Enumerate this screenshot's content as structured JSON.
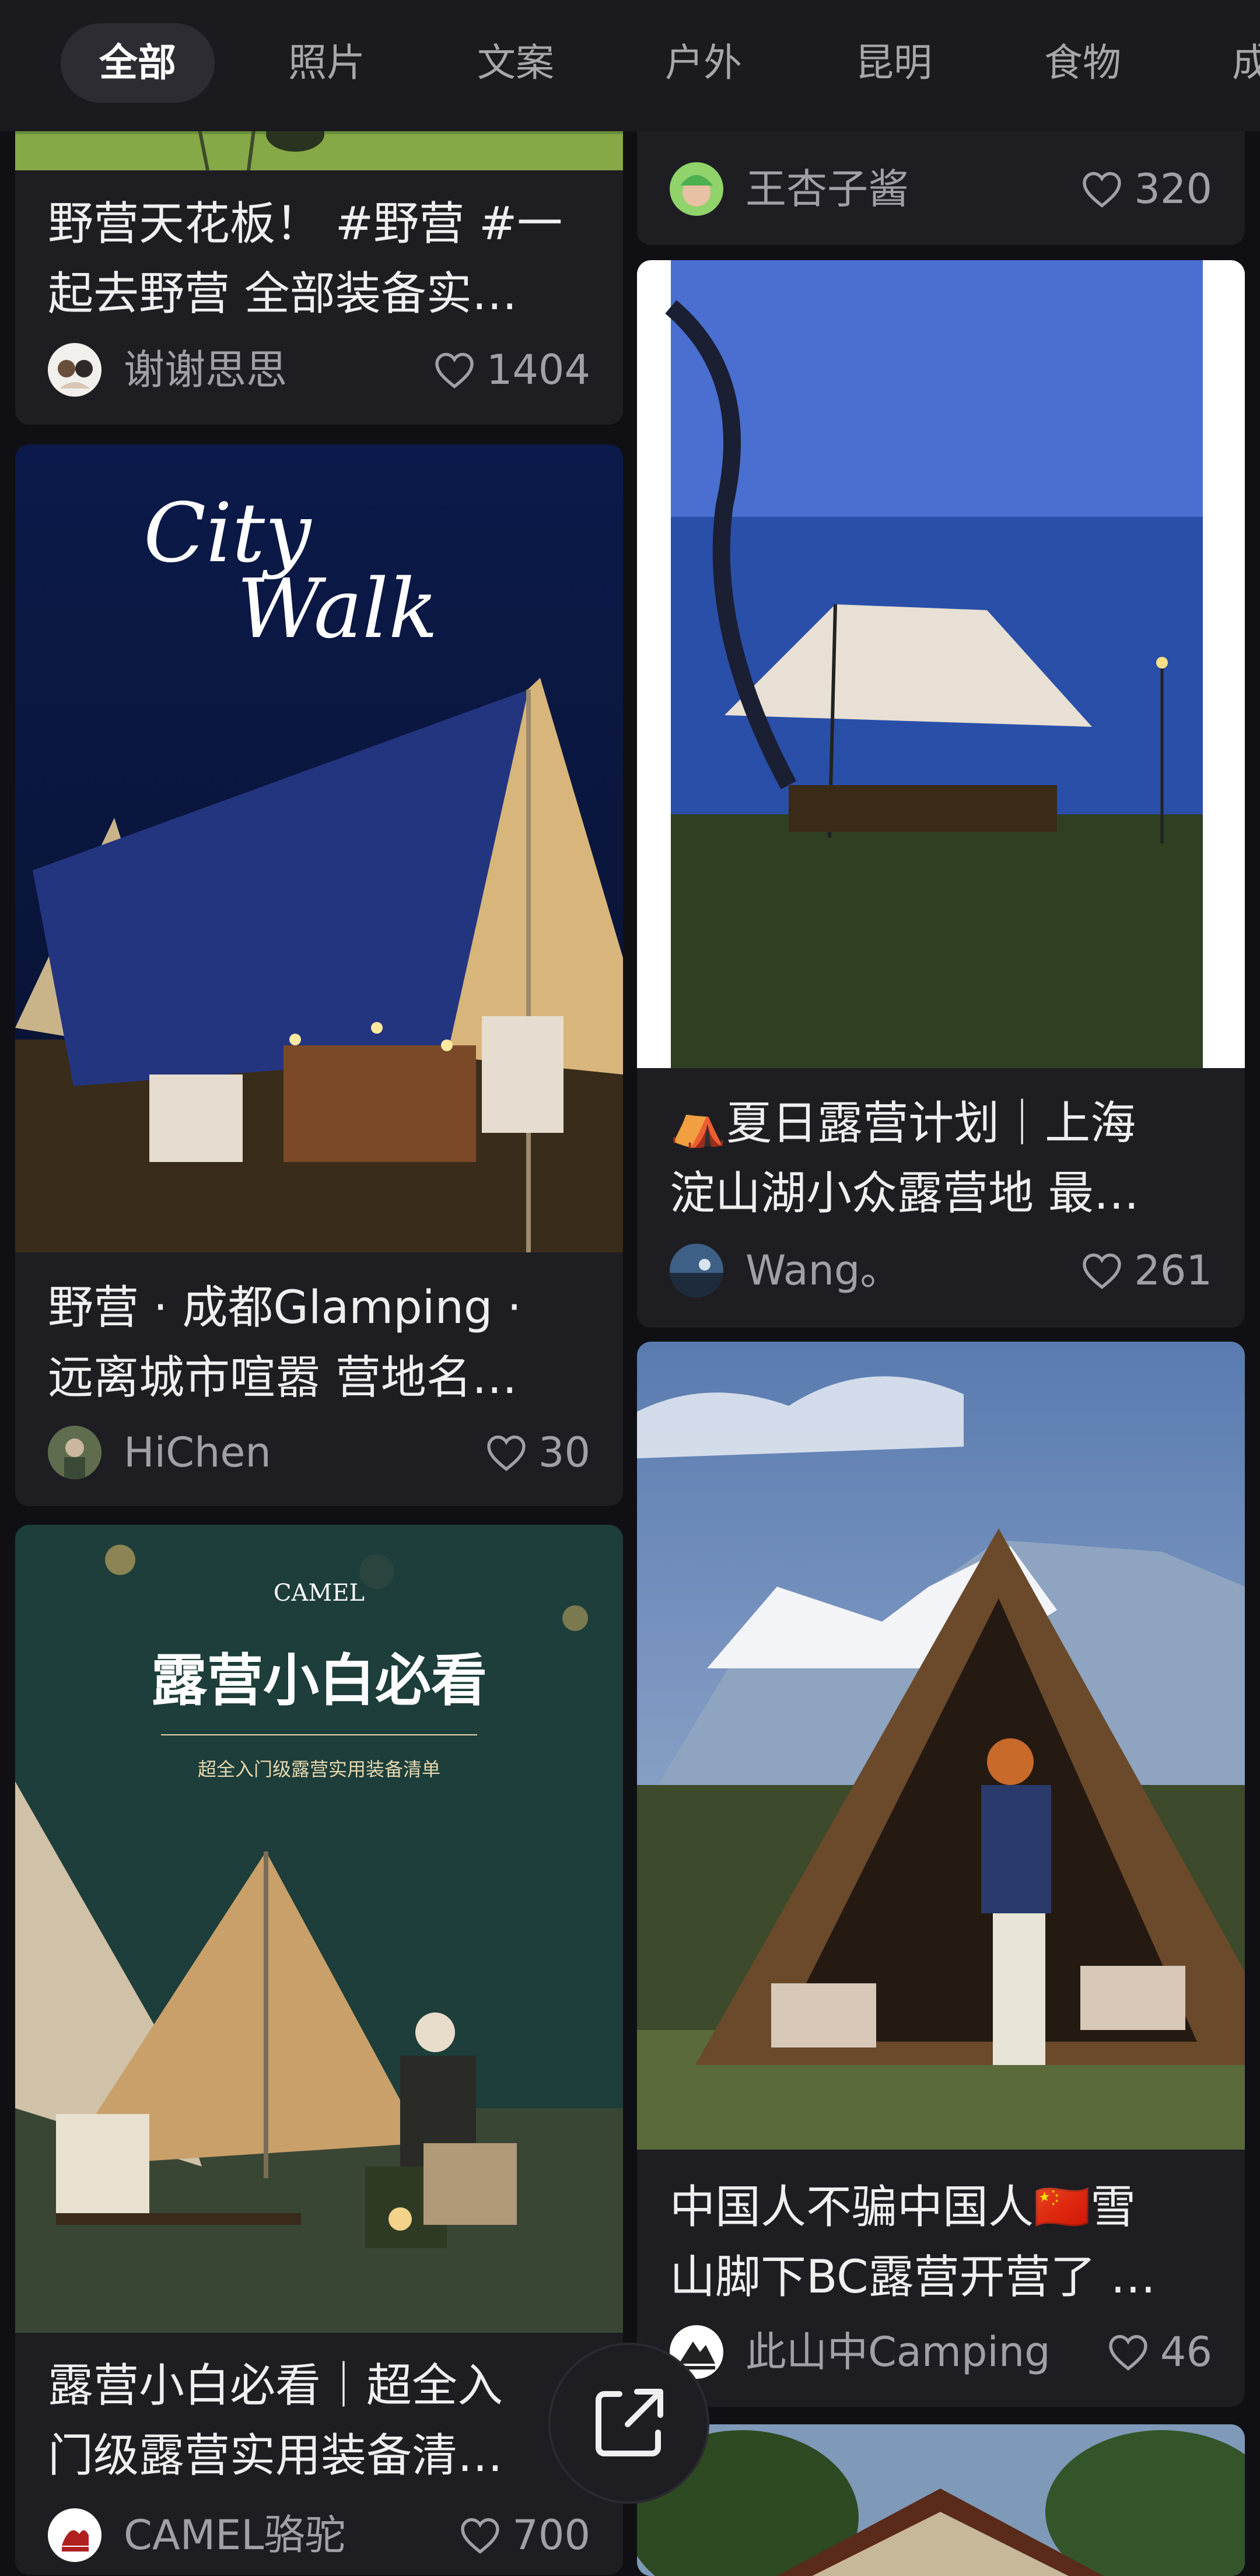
{
  "tabs": [
    "全部",
    "照片",
    "文案",
    "户外",
    "昆明",
    "食物",
    "成"
  ],
  "active_tab": "全部",
  "overlay_texts": {
    "city_walk": "City Walk",
    "camel_logo": "CAMEL",
    "camel_headline": "露营小白必看",
    "camel_sub": "超全入门级露营实用装备清单"
  },
  "posts": [
    {
      "title_lines": [
        "野营天花板！ #野营 #一",
        "起去野营 全部装备实…"
      ],
      "author": "谢谢思思",
      "likes": "1404"
    },
    {
      "title_lines": [],
      "author": "王杏子酱",
      "likes": "320"
    },
    {
      "title_lines": [
        "野营 · 成都Glamping ·",
        "远离城市喧嚣 营地名…"
      ],
      "author": "HiChen",
      "likes": "30"
    },
    {
      "title_lines": [
        "⛺夏日露营计划｜上海",
        "淀山湖小众露营地 最…"
      ],
      "author": "Wang。",
      "likes": "261"
    },
    {
      "title_lines": [
        "露营小白必看｜超全入",
        "门级露营实用装备清…"
      ],
      "author": "CAMEL骆驼",
      "likes": "700"
    },
    {
      "title_lines": [
        "中国人不骗中国人🇨🇳雪",
        "山脚下BC露营开营了 …"
      ],
      "author": "此山中Camping",
      "likes": "46"
    }
  ],
  "icons": {
    "like": "heart-outline-icon",
    "share": "share-external-icon"
  },
  "colors": {
    "background": "#101014",
    "card": "#1e1e22",
    "tabbar": "#1a1a1f",
    "active_tab_pill": "#2c2c32"
  }
}
